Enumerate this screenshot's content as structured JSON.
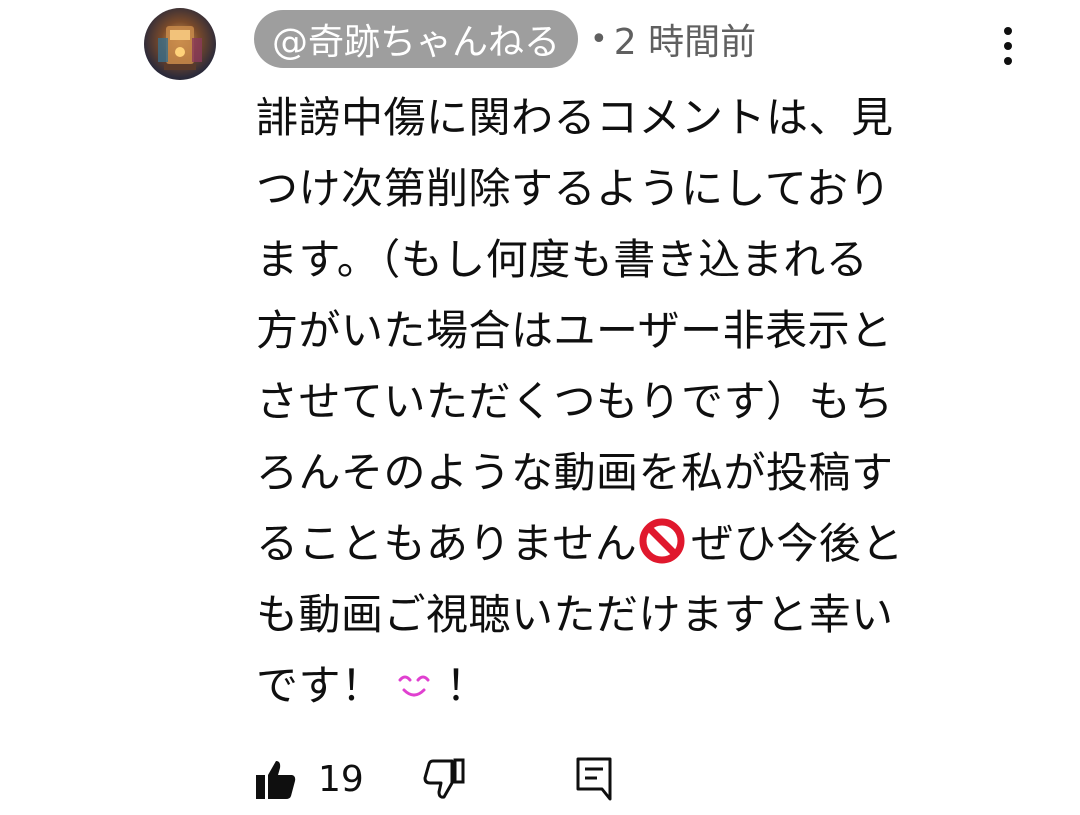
{
  "comment": {
    "author": "@奇跡ちゃんねる",
    "separator": "•",
    "time": "2 時間前",
    "lines": [
      "誹謗中傷に関わるコメントは、見",
      "つけ次第削除するようにしており",
      "ます。（もし何度も書き込まれる",
      "方がいた場合はユーザー非表示と",
      "させていただくつもりです）もち",
      "ろんそのような動画を私が投稿す",
      "こともありません",
      "ぜひ今後と",
      "も動画ご視聴いただけますと幸い",
      "です！",
      "！"
    ],
    "line7_prefix": "る",
    "likes": "19"
  },
  "icons": {
    "menu": "more-vert-icon",
    "noentry": "no-entry-sign-emoji",
    "smile": "smiling-eyes-emoji",
    "like": "thumb-up-icon",
    "dislike": "thumb-down-icon",
    "reply": "comment-reply-icon"
  },
  "colors": {
    "handle_bg": "#9e9e9e",
    "text": "#0f0f0f",
    "meta": "#606060",
    "noentry": "#e0182d",
    "smile": "#e040d0"
  }
}
